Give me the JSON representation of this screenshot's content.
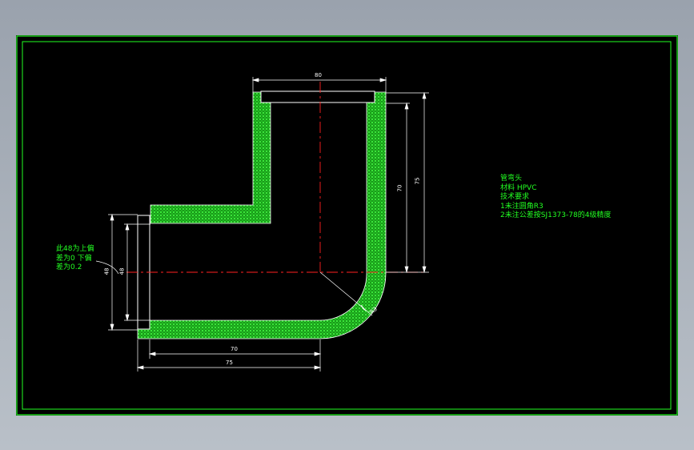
{
  "colors": {
    "background": "#000000",
    "frame": "#22ff22",
    "section_hatch": "#22dd22",
    "outline": "#ffffff",
    "centerline": "#ff2020",
    "dimension": "#ffffff",
    "notes_text": "#22ff22"
  },
  "dimensions": {
    "top_width": "80",
    "right_inner_height": "70",
    "right_outer_height": "75",
    "left_inner_dia": "48",
    "left_outer_dia": "48",
    "bottom_inner_length": "70",
    "bottom_outer_length": "75",
    "bend_radius": "R3"
  },
  "notes_left": {
    "line1": "此48为上偏",
    "line2": "差为0 下偏",
    "line3": "差为0.2"
  },
  "notes_right": {
    "title": "管弯头",
    "material": "材料  HPVC",
    "req_heading": "技术要求",
    "req1": "1未注圆角R3",
    "req2": "2未注公差按SJ1373-78的4级精度"
  }
}
